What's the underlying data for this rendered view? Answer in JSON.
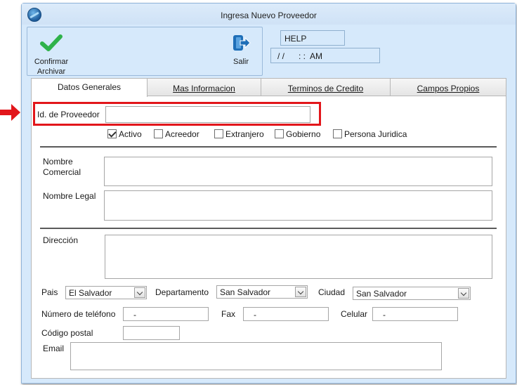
{
  "window": {
    "title": "Ingresa Nuevo Proveedor"
  },
  "toolbar": {
    "confirm_line1": "Confirmar",
    "confirm_line2": "Archivar",
    "exit_label": "Salir"
  },
  "status": {
    "help": "HELP",
    "datetime": "/ /      : :  AM"
  },
  "tabs": [
    {
      "label": "Datos Generales",
      "active": true
    },
    {
      "label": "Mas Informacion",
      "active": false
    },
    {
      "label": "Terminos de Credito",
      "active": false
    },
    {
      "label": "Campos Propios",
      "active": false
    }
  ],
  "form": {
    "id_proveedor": {
      "label": "Id. de Proveedor",
      "value": ""
    },
    "checkboxes": [
      {
        "label": "Activo",
        "checked": true
      },
      {
        "label": "Acreedor",
        "checked": false
      },
      {
        "label": "Extranjero",
        "checked": false
      },
      {
        "label": "Gobierno",
        "checked": false
      },
      {
        "label": "Persona Juridica",
        "checked": false
      }
    ],
    "nombre_comercial": {
      "label_line1": "Nombre",
      "label_line2": "Comercial",
      "value": ""
    },
    "nombre_legal": {
      "label": "Nombre Legal",
      "value": ""
    },
    "direccion": {
      "label": "Dirección",
      "value": ""
    },
    "pais": {
      "label": "Pais",
      "value": "El Salvador"
    },
    "departamento": {
      "label": "Departamento",
      "value": "San Salvador"
    },
    "ciudad": {
      "label": "Ciudad",
      "value": "San Salvador"
    },
    "telefono": {
      "label": "Número de teléfono",
      "value": "-"
    },
    "fax": {
      "label": "Fax",
      "value": "-"
    },
    "celular": {
      "label": "Celular",
      "value": "-"
    },
    "codigo_postal": {
      "label": "Código postal",
      "value": ""
    },
    "email": {
      "label": "Email",
      "value": ""
    }
  },
  "colors": {
    "highlight": "#e2161b",
    "window_bg": "#d6e9fb",
    "accent": "#1d5b9a"
  }
}
